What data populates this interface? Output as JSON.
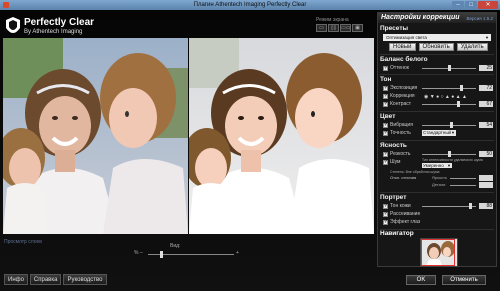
{
  "window": {
    "title": "Плагин Athentech Imaging Perfectly Clear",
    "min_glyph": "–",
    "max_glyph": "□",
    "close_glyph": "✕"
  },
  "logo": {
    "name": "Perfectly Clear",
    "subtitle": "By Athentech Imaging"
  },
  "toolbar": {
    "view_mode_label": "Режим экрана",
    "view_buttons": [
      "▭",
      "▯▯",
      "▭▭",
      "▣"
    ]
  },
  "bottom": {
    "compare_link": "Просмотр слоев",
    "view_label": "Вид:",
    "zoom_percent": "% –",
    "zoom_end": "+",
    "zoom_level": 0.14
  },
  "footer": {
    "info_button": "Инфо",
    "help_button": "Справка",
    "guide_button": "Руководство"
  },
  "panel": {
    "title": "Настройки коррекции",
    "version": "Версия 1.5.2",
    "presets": {
      "title": "Пресеты",
      "selected": "Оптимизация света",
      "buttons": [
        "Новый",
        "Обновить",
        "Удалить"
      ]
    },
    "white_balance": {
      "title": "Баланс белого",
      "tint": {
        "label": "Оттенок",
        "value": "25",
        "level": 0.5
      }
    },
    "tone": {
      "title": "Тон",
      "exposure": {
        "label": "Экспозиция",
        "value": "72",
        "level": 0.72
      },
      "correction": {
        "label": "Коррекция"
      },
      "contrast": {
        "label": "Контраст",
        "value": "67",
        "level": 0.67
      }
    },
    "color": {
      "title": "Цвет",
      "vibrancy": {
        "label": "Вибрация",
        "value": "54",
        "level": 0.54
      },
      "accuracy": {
        "label": "Точность",
        "value": "Стандартный"
      }
    },
    "sharpness": {
      "title": "Ясность",
      "sharpness": {
        "label": "Резкость",
        "value": "50",
        "level": 0.5
      },
      "noise": {
        "label": "Шум",
        "value": "Умеренно"
      },
      "noise_note": "Тип интенсивности удаляемого шума",
      "strength_label": "Степень: Вне обработки шума",
      "skin_label": "Откл. отличия",
      "brightness_label": "Яркость",
      "detail_label": "Детали"
    },
    "portrait": {
      "title": "Портрет",
      "skin_tone": {
        "label": "Тон кожи",
        "value": "88",
        "level": 0.88
      },
      "smoothing": {
        "label": "Рассеивание"
      },
      "eye_effect": {
        "label": "Эффект глаз"
      }
    },
    "navigator": {
      "title": "Навигатор"
    }
  },
  "dialog": {
    "ok_button": "OK",
    "cancel_button": "Отменить"
  },
  "colors": {
    "background": "#0a0a0a",
    "title_bar": "#6f97c1",
    "close_button": "#c9463d",
    "navigator_frame": "#e03030"
  }
}
